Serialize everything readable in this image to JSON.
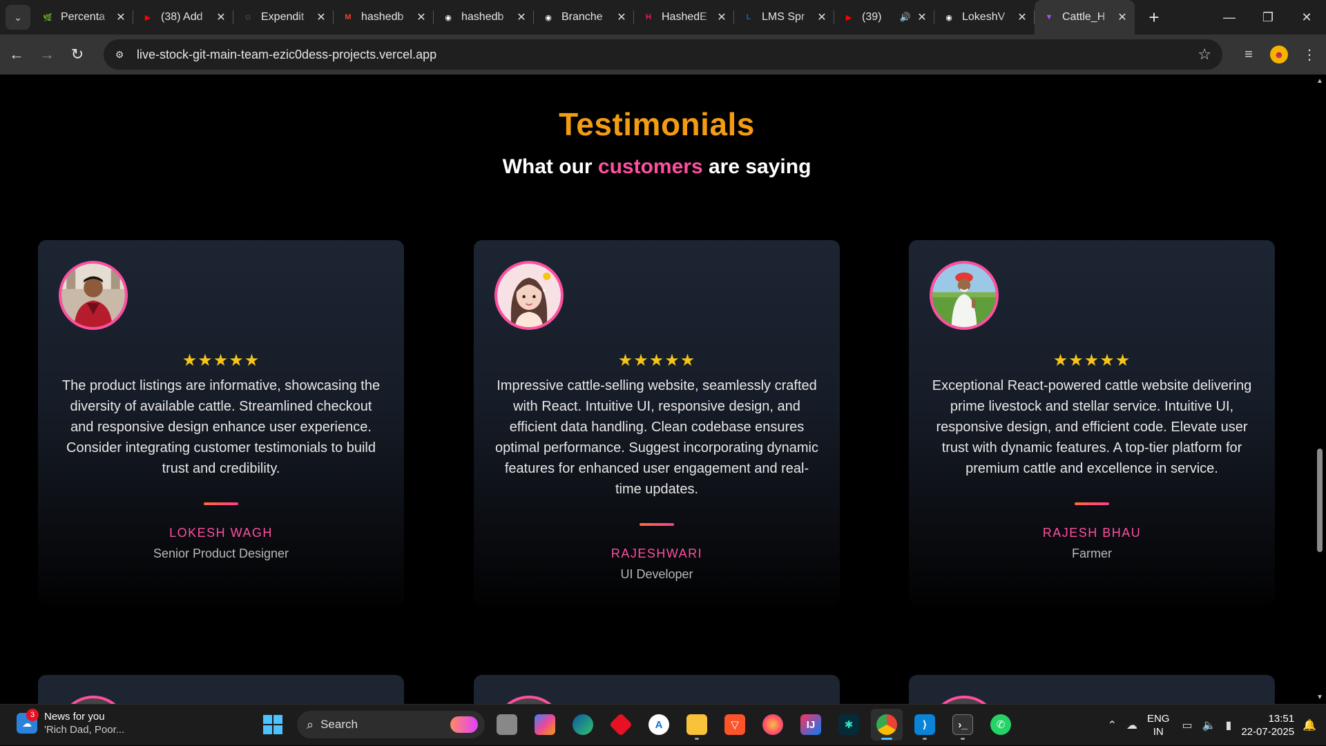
{
  "browser": {
    "tabs": [
      {
        "title": "Percenta",
        "favicon_color": "#2e7d32",
        "favicon_char": "🌿",
        "active": false
      },
      {
        "title": "(38) Add",
        "favicon_color": "#ff0000",
        "favicon_char": "▶",
        "active": false
      },
      {
        "title": "Expendit",
        "favicon_color": "#444444",
        "favicon_char": "⚙",
        "active": false
      },
      {
        "title": "hashedb",
        "favicon_color": "#ea4335",
        "favicon_char": "M",
        "active": false
      },
      {
        "title": "hashedb",
        "favicon_color": "#ffffff",
        "favicon_char": "◉",
        "active": false
      },
      {
        "title": "Branche",
        "favicon_color": "#ffffff",
        "favicon_char": "◉",
        "active": false
      },
      {
        "title": "HashedE",
        "favicon_color": "#e91e63",
        "favicon_char": "H",
        "active": false
      },
      {
        "title": "LMS Spr",
        "favicon_color": "#1565c0",
        "favicon_char": "L",
        "active": false
      },
      {
        "title": "(39)",
        "favicon_color": "#ff0000",
        "favicon_char": "▶",
        "active": false,
        "audio": "🔊"
      },
      {
        "title": "LokeshV",
        "favicon_color": "#ffffff",
        "favicon_char": "◉",
        "active": false
      },
      {
        "title": "Cattle_H",
        "favicon_color": "#a855f7",
        "favicon_char": "▼",
        "active": true
      }
    ],
    "url": "live-stock-git-main-team-ezic0dess-projects.vercel.app"
  },
  "page": {
    "title": "Testimonials",
    "subtitle_before": "What our ",
    "subtitle_highlight": "customers",
    "subtitle_after": " are saying",
    "accent_color": "#ff4fa0",
    "title_color": "#f39c12",
    "testimonials": [
      {
        "rating": "★★★★★",
        "text": "The product listings are informative, showcasing the diversity of available cattle. Streamlined checkout and responsive design enhance user experience. Consider integrating customer testimonials to build trust and credibility.",
        "name": "LOKESH WAGH",
        "role": "Senior Product Designer",
        "avatar": "man-photo"
      },
      {
        "rating": "★★★★★",
        "text": "Impressive cattle-selling website, seamlessly crafted with React. Intuitive UI, responsive design, and efficient data handling. Clean codebase ensures optimal performance. Suggest incorporating dynamic features for enhanced user engagement and real-time updates.",
        "name": "RAJESHWARI",
        "role": "UI Developer",
        "avatar": "woman-illustration"
      },
      {
        "rating": "★★★★★",
        "text": "Exceptional React-powered cattle website delivering prime livestock and stellar service. Intuitive UI, responsive design, and efficient code. Elevate user trust with dynamic features. A top-tier platform for premium cattle and excellence in service.",
        "name": "RAJESH BHAU",
        "role": "Farmer",
        "avatar": "farmer-photo"
      }
    ]
  },
  "taskbar": {
    "news_title": "News for you",
    "news_sub": "'Rich Dad, Poor...",
    "news_badge": "3",
    "search_label": "Search",
    "lang_line1": "ENG",
    "lang_line2": "IN",
    "time": "13:51",
    "date": "22-07-2025"
  }
}
